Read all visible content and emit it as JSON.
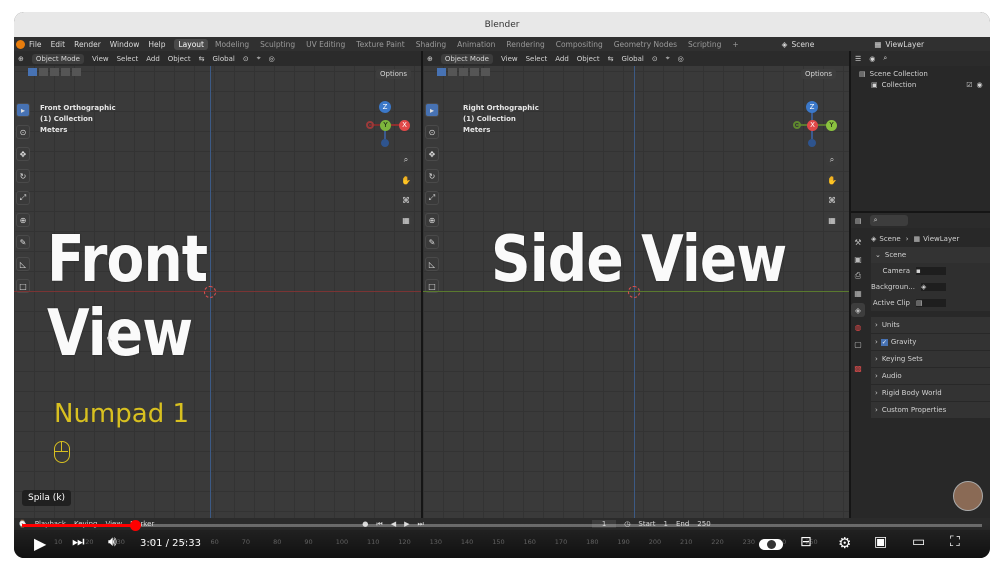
{
  "window": {
    "title": "Blender"
  },
  "menu": [
    "File",
    "Edit",
    "Render",
    "Window",
    "Help"
  ],
  "workspaces": [
    "Layout",
    "Modeling",
    "Sculpting",
    "UV Editing",
    "Texture Paint",
    "Shading",
    "Animation",
    "Rendering",
    "Compositing",
    "Geometry Nodes",
    "Scripting",
    "+"
  ],
  "active_workspace": "Layout",
  "scene_name": "Scene",
  "view_layer_name": "ViewLayer",
  "viewport_header": {
    "mode": "Object Mode",
    "items": [
      "View",
      "Select",
      "Add",
      "Object"
    ],
    "orientation": "Global",
    "options": "Options"
  },
  "left_view": {
    "overlay_lines": [
      "Front Orthographic",
      "(1) Collection",
      "Meters"
    ],
    "caption": "Front View",
    "hint": "Numpad 1"
  },
  "right_view": {
    "overlay_lines": [
      "Right Orthographic",
      "(1) Collection",
      "Meters"
    ],
    "caption": "Side View"
  },
  "gizmo": {
    "left": {
      "center": "Y",
      "top": "Z",
      "right": "X"
    },
    "right": {
      "center": "X",
      "top": "Z",
      "right": "Y"
    }
  },
  "outliner": {
    "items": [
      "Scene Collection",
      "Collection"
    ]
  },
  "properties": {
    "breadcrumb": [
      "Scene",
      "ViewLayer"
    ],
    "section": "Scene",
    "fields": [
      {
        "label": "Camera"
      },
      {
        "label": "Backgroun..."
      },
      {
        "label": "Active Clip"
      }
    ],
    "panels": [
      "Units",
      "Gravity",
      "Keying Sets",
      "Audio",
      "Rigid Body World",
      "Custom Properties"
    ]
  },
  "timeline": {
    "menu": [
      "Playback",
      "Keying",
      "View",
      "Marker"
    ],
    "current_frame": "1",
    "start_label": "Start",
    "start": "1",
    "end_label": "End",
    "end": "250",
    "ticks": [
      "10",
      "20",
      "30",
      "40",
      "50",
      "60",
      "70",
      "80",
      "90",
      "100",
      "110",
      "120",
      "130",
      "140",
      "150",
      "160",
      "170",
      "180",
      "190",
      "200",
      "210",
      "220",
      "230",
      "240",
      "250"
    ]
  },
  "player": {
    "tooltip": "Spila (k)",
    "time": "3:01 / 25:33",
    "progress": 0.118
  },
  "colors": {
    "accent": "#4772b3",
    "youtube_red": "#ff0000",
    "numpad_yellow": "#d8c020"
  }
}
